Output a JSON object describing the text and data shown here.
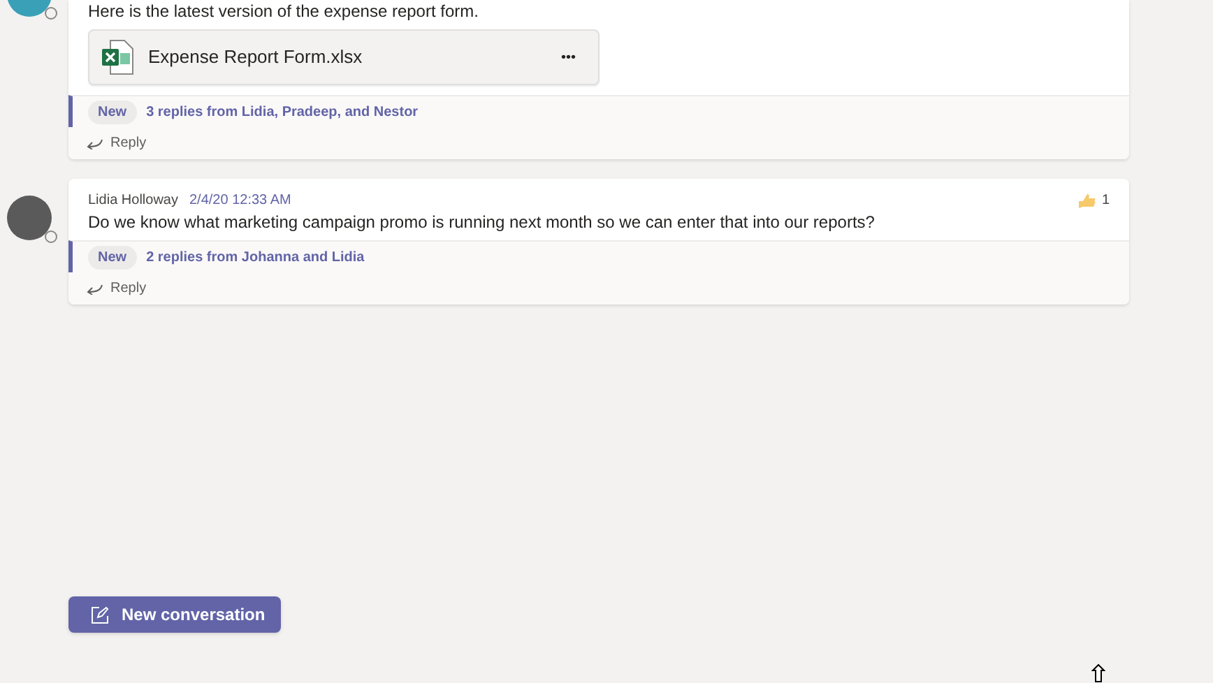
{
  "messages": [
    {
      "body": "Here is the latest version of the expense report form.",
      "attachment": {
        "name": "Expense Report Form.xlsx",
        "more": "•••"
      },
      "replies": {
        "badge": "New",
        "summary": "3 replies from Lidia, Pradeep, and Nestor"
      },
      "reply_label": "Reply"
    },
    {
      "author": "Lidia Holloway",
      "timestamp": "2/4/20 12:33 AM",
      "body": "Do we know what marketing campaign promo is running next month so we can enter that into our reports?",
      "reaction": {
        "count": "1"
      },
      "replies": {
        "badge": "New",
        "summary": "2 replies from Johanna and Lidia"
      },
      "reply_label": "Reply"
    }
  ],
  "new_conversation_button": "New conversation"
}
